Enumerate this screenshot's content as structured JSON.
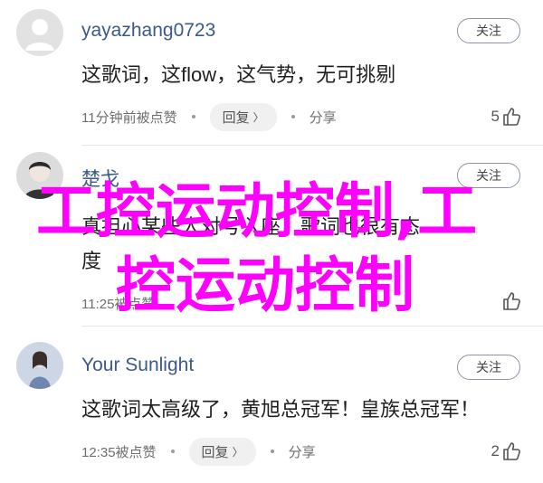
{
  "comments": [
    {
      "username": "yayazhang0723",
      "follow_label": "关注",
      "text": "这歌词，这flow，这气势，无可挑剔",
      "time_action": "11分钟前被点赞",
      "reply_label": "回复",
      "share_label": "分享",
      "likes": "5"
    },
    {
      "username": "楚戈",
      "follow_label": "关注",
      "text_line1": "真担心某些人对号入座，歌词也很有态",
      "text_line2": "度",
      "time_action": "11:25被点赞",
      "reply_label": "回复",
      "share_label": "分享",
      "likes": ""
    },
    {
      "username": "Your Sunlight",
      "follow_label": "关注",
      "text": "这歌词太高级了，黄旭总冠军！皇族总冠军！",
      "time_action": "12:35被点赞",
      "reply_label": "回复",
      "share_label": "分享",
      "likes": "2"
    }
  ],
  "watermark": {
    "line1": "工控运动控制,工",
    "line2": "控运动控制",
    "color": "#ff00ff"
  }
}
